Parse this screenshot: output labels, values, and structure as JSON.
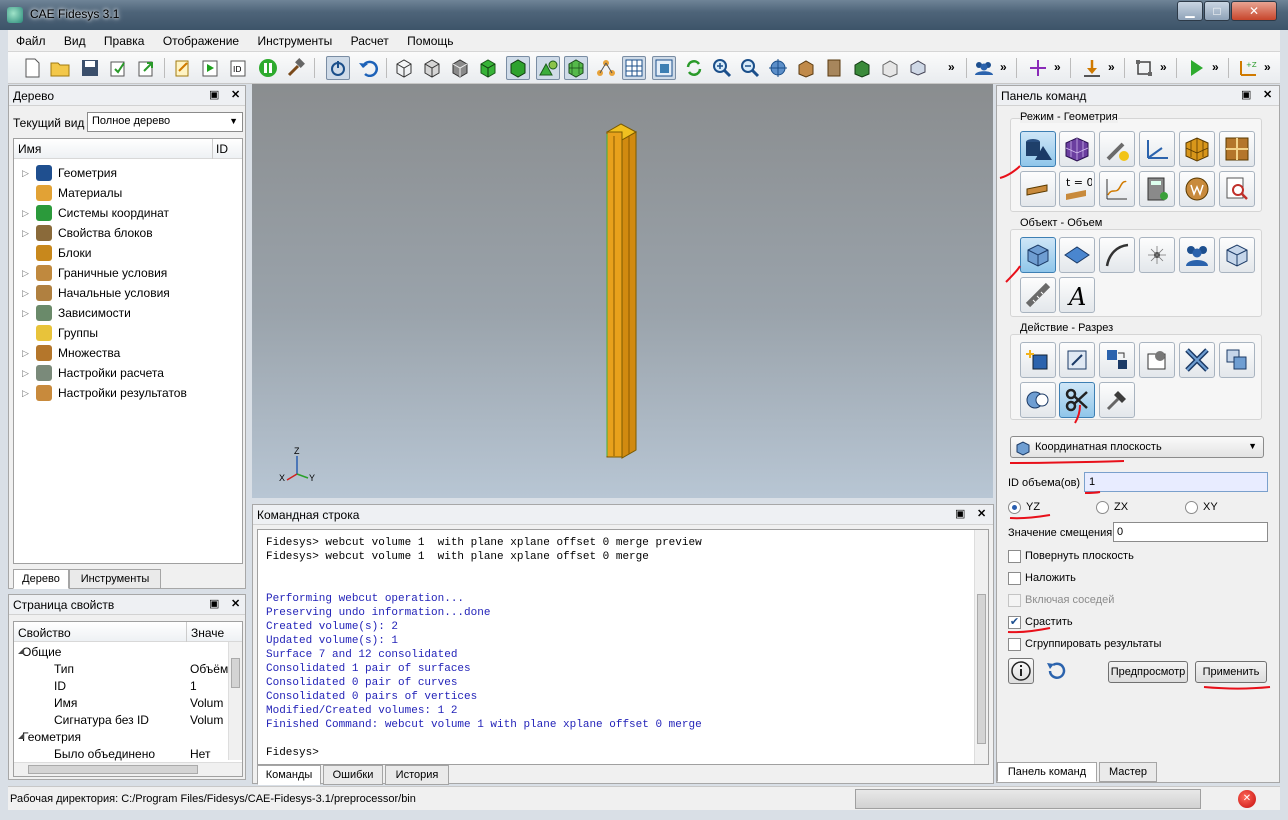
{
  "window": {
    "title": "CAE Fidesys 3.1"
  },
  "menu": [
    "Файл",
    "Вид",
    "Правка",
    "Отображение",
    "Инструменты",
    "Расчет",
    "Помощь"
  ],
  "toolbar": {
    "more": "»"
  },
  "tree_panel": {
    "title": "Дерево",
    "current_view_label": "Текущий вид",
    "current_view_value": "Полное дерево",
    "col_name": "Имя",
    "col_id": "ID",
    "items": [
      {
        "label": "Геометрия",
        "icon": "geometry-icon",
        "expandable": true
      },
      {
        "label": "Материалы",
        "icon": "materials-icon",
        "expandable": false
      },
      {
        "label": "Системы координат",
        "icon": "coordinate-systems-icon",
        "expandable": true
      },
      {
        "label": "Свойства блоков",
        "icon": "block-properties-icon",
        "expandable": true
      },
      {
        "label": "Блоки",
        "icon": "blocks-icon",
        "expandable": false
      },
      {
        "label": "Граничные условия",
        "icon": "boundary-conditions-icon",
        "expandable": true
      },
      {
        "label": "Начальные условия",
        "icon": "initial-conditions-icon",
        "expandable": true
      },
      {
        "label": "Зависимости",
        "icon": "dependencies-icon",
        "expandable": true
      },
      {
        "label": "Группы",
        "icon": "groups-icon",
        "expandable": false
      },
      {
        "label": "Множества",
        "icon": "sets-icon",
        "expandable": true
      },
      {
        "label": "Настройки расчета",
        "icon": "calc-settings-icon",
        "expandable": true
      },
      {
        "label": "Настройки результатов",
        "icon": "result-settings-icon",
        "expandable": true
      }
    ],
    "tabs": [
      "Дерево",
      "Инструменты"
    ]
  },
  "properties_panel": {
    "title": "Страница свойств",
    "col_property": "Свойство",
    "col_value": "Значе",
    "rows": [
      {
        "name": "Общие",
        "value": "",
        "level": 0,
        "group": true
      },
      {
        "name": "Тип",
        "value": "Объём",
        "level": 1,
        "group": false
      },
      {
        "name": "ID",
        "value": "1",
        "level": 1,
        "group": false
      },
      {
        "name": "Имя",
        "value": "Volum",
        "level": 1,
        "group": false
      },
      {
        "name": "Сигнатура без ID",
        "value": "Volum",
        "level": 1,
        "group": false
      },
      {
        "name": "Геометрия",
        "value": "",
        "level": 0,
        "group": true
      },
      {
        "name": "Было объединено",
        "value": "Нет",
        "level": 1,
        "group": false
      }
    ]
  },
  "viewport": {
    "axis_z": "Z",
    "axis_x": "X",
    "axis_y": "Y"
  },
  "command_panel": {
    "title": "Командная строка",
    "lines": [
      {
        "text": "Fidesys> webcut volume 1  with plane xplane offset 0 merge preview",
        "kind": "cmd"
      },
      {
        "text": "Fidesys> webcut volume 1  with plane xplane offset 0 merge",
        "kind": "cmd"
      },
      {
        "text": "",
        "kind": "out"
      },
      {
        "text": "",
        "kind": "out"
      },
      {
        "text": "Performing webcut operation...",
        "kind": "out"
      },
      {
        "text": "Preserving undo information...done",
        "kind": "out"
      },
      {
        "text": "Created volume(s): 2",
        "kind": "out"
      },
      {
        "text": "Updated volume(s): 1",
        "kind": "out"
      },
      {
        "text": "Surface 7 and 12 consolidated",
        "kind": "out"
      },
      {
        "text": "Consolidated 1 pair of surfaces",
        "kind": "out"
      },
      {
        "text": "Consolidated 0 pair of curves",
        "kind": "out"
      },
      {
        "text": "Consolidated 0 pairs of vertices",
        "kind": "out"
      },
      {
        "text": "Modified/Created volumes: 1 2",
        "kind": "out"
      },
      {
        "text": "Finished Command: webcut volume 1 with plane xplane offset 0 merge",
        "kind": "out"
      },
      {
        "text": "",
        "kind": "out"
      },
      {
        "text": "Fidesys>",
        "kind": "cmd"
      }
    ],
    "tabs": [
      "Команды",
      "Ошибки",
      "История"
    ]
  },
  "control_panel": {
    "title": "Панель команд",
    "mode_group": "Режим - Геометрия",
    "object_group": "Объект - Объем",
    "action_group": "Действие - Разрез",
    "method_select": "Координатная плоскость",
    "volume_id_label": "ID объема(ов)",
    "volume_id_value": "1",
    "radio": [
      {
        "label": "YZ",
        "checked": true
      },
      {
        "label": "ZX",
        "checked": false
      },
      {
        "label": "XY",
        "checked": false
      }
    ],
    "offset_label": "Значение смещения",
    "offset_value": "0",
    "checkboxes": [
      {
        "label": "Повернуть плоскость",
        "checked": false,
        "enabled": true
      },
      {
        "label": "Наложить",
        "checked": false,
        "enabled": true
      },
      {
        "label": "Включая соседей",
        "checked": false,
        "enabled": false
      },
      {
        "label": "Срастить",
        "checked": true,
        "enabled": true
      },
      {
        "label": "Сгруппировать результаты",
        "checked": false,
        "enabled": true
      }
    ],
    "preview_button": "Предпросмотр",
    "apply_button": "Применить",
    "tabs": [
      "Панель команд",
      "Мастер"
    ]
  },
  "status_bar": {
    "text": "Рабочая директория: C:/Program Files/Fidesys/CAE-Fidesys-3.1/preprocessor/bin"
  },
  "colors": {
    "accent": "#3d7fb3",
    "annotation_red": "#e8101a",
    "output_blue": "#2323b8"
  }
}
